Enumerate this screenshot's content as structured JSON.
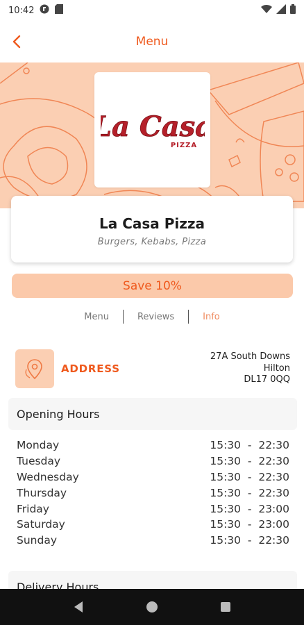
{
  "status_bar": {
    "time": "10:42"
  },
  "header": {
    "title": "Menu"
  },
  "restaurant": {
    "logo_text": "La Casa",
    "logo_subtext": "PIZZA",
    "name": "La Casa Pizza",
    "tags": "Burgers, Kebabs, Pizza"
  },
  "promo": {
    "label": "Save 10%"
  },
  "tabs": [
    {
      "label": "Menu",
      "active": false
    },
    {
      "label": "Reviews",
      "active": false
    },
    {
      "label": "Info",
      "active": true
    }
  ],
  "address": {
    "label": "ADDRESS",
    "lines": [
      "27A South Downs",
      "Hilton",
      "DL17 0QQ"
    ]
  },
  "opening_hours": {
    "title": "Opening Hours",
    "rows": [
      {
        "day": "Monday",
        "time": "15:30  -  22:30"
      },
      {
        "day": "Tuesday",
        "time": "15:30  -  22:30"
      },
      {
        "day": "Wednesday",
        "time": "15:30  -  22:30"
      },
      {
        "day": "Thursday",
        "time": "15:30  -  22:30"
      },
      {
        "day": "Friday",
        "time": "15:30  -  23:00"
      },
      {
        "day": "Saturday",
        "time": "15:30  -  23:00"
      },
      {
        "day": "Sunday",
        "time": "15:30  -  22:30"
      }
    ]
  },
  "delivery_hours": {
    "title": "Delivery Hours"
  },
  "colors": {
    "accent": "#ef5a1e",
    "hero_bg": "#fbcfb3",
    "promo_bg": "#fbc9aa",
    "logo_red": "#b5202a"
  },
  "icons": [
    "back-arrow-icon",
    "wifi-icon",
    "signal-icon",
    "battery-icon",
    "location-pin-icon",
    "nav-back-icon",
    "nav-home-icon",
    "nav-recents-icon"
  ]
}
